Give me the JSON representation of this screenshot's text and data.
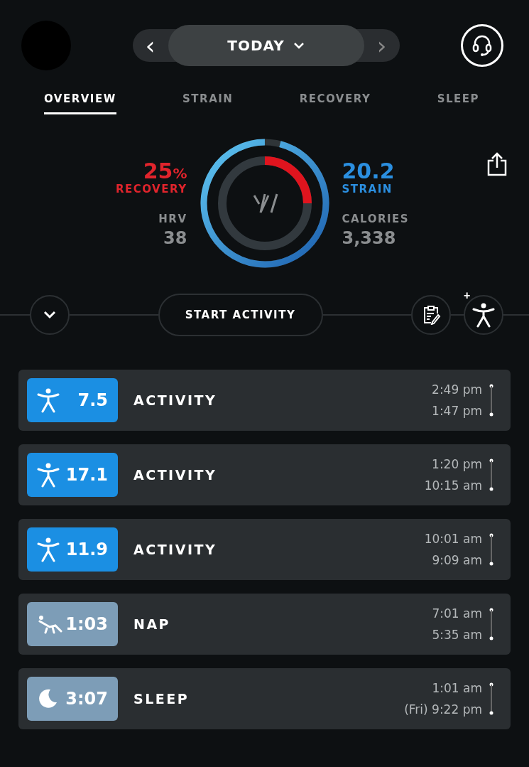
{
  "header": {
    "date_label": "TODAY",
    "prev": "‹",
    "next": "›"
  },
  "tabs": [
    {
      "label": "OVERVIEW",
      "selected": true
    },
    {
      "label": "STRAIN",
      "selected": false
    },
    {
      "label": "RECOVERY",
      "selected": false
    },
    {
      "label": "SLEEP",
      "selected": false
    }
  ],
  "summary": {
    "recovery": {
      "value": "25",
      "unit": "%",
      "label": "RECOVERY"
    },
    "hrv": {
      "label": "HRV",
      "value": "38"
    },
    "strain": {
      "value": "20.2",
      "label": "STRAIN"
    },
    "calories": {
      "label": "CALORIES",
      "value": "3,338"
    }
  },
  "actions": {
    "start": "START ACTIVITY",
    "add": "+"
  },
  "activities": [
    {
      "kind": "activity",
      "score": "7.5",
      "name": "ACTIVITY",
      "end": "2:49 pm",
      "start": "1:47 pm"
    },
    {
      "kind": "activity",
      "score": "17.1",
      "name": "ACTIVITY",
      "end": "1:20 pm",
      "start": "10:15 am"
    },
    {
      "kind": "activity",
      "score": "11.9",
      "name": "ACTIVITY",
      "end": "10:01 am",
      "start": "9:09 am"
    },
    {
      "kind": "nap",
      "score": "1:03",
      "name": "NAP",
      "end": "7:01 am",
      "start": "5:35 am"
    },
    {
      "kind": "sleep",
      "score": "3:07",
      "name": "SLEEP",
      "end": "1:01 am",
      "start": "(Fri) 9:22 pm"
    }
  ]
}
